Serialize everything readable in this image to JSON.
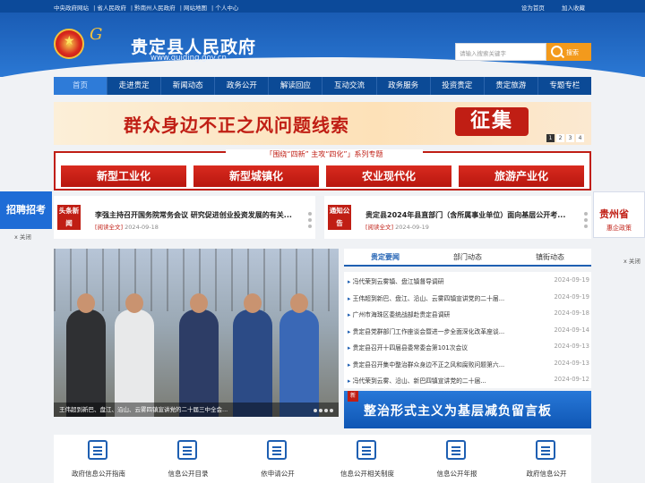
{
  "topbar": {
    "links": [
      "中央政府网站",
      "省人民政府",
      "黔南州人民政府",
      "网站地图",
      "个人中心"
    ],
    "right_links": [
      "设为首页",
      "加入收藏"
    ]
  },
  "header": {
    "title": "贵定县人民政府",
    "url": "www.guiding.gov.cn",
    "search_placeholder": "请输入搜索关键字",
    "search_label": "搜索"
  },
  "nav": {
    "items": [
      "首页",
      "走进贵定",
      "新闻动态",
      "政务公开",
      "解读回应",
      "互动交流",
      "政务服务",
      "投资贵定",
      "贵定旅游",
      "专题专栏"
    ]
  },
  "banner": {
    "text": "群众身边不正之风问题线索",
    "badge": "征集",
    "pages": [
      "1",
      "2",
      "3",
      "4"
    ]
  },
  "sihua": {
    "header": "「围绕“四新” 主攻“四化”」系列专题",
    "items": [
      "新型工业化",
      "新型城镇化",
      "农业现代化",
      "旅游产业化"
    ]
  },
  "headlines": [
    {
      "tag": "头条新闻",
      "title": "李强主持召开国务院常务会议 研究促进创业投资发展的有关...",
      "read": "[阅读全文]",
      "date": "2024-09-18"
    },
    {
      "tag": "通知公告",
      "title": "贵定县2024年县直部门（含所属事业单位）面向基层公开考...",
      "read": "[阅读全文]",
      "date": "2024-09-19"
    }
  ],
  "float": {
    "left_text": "招聘招考",
    "right_text": "贵州省",
    "right_sub": "惠企政策",
    "close": "x 关闭"
  },
  "photo": {
    "caption": "王伟超到新巴、盘江、沿山、云雾四镇宣讲党的二十届三中全会..."
  },
  "news": {
    "tabs": [
      "贵定要闻",
      "部门动态",
      "镇街动态"
    ],
    "items": [
      {
        "title": "冯代荣到云雾镇、盘江镇督导调研",
        "date": "2024-09-19"
      },
      {
        "title": "王伟超到新巴、盘江、沿山、云雾四镇宣讲党的二十届...",
        "date": "2024-09-19"
      },
      {
        "title": "广州市海珠区委统战部赴贵定县调研",
        "date": "2024-09-18"
      },
      {
        "title": "贵定县党群部门工作座谈会暨进一步全面深化改革座谈...",
        "date": "2024-09-14"
      },
      {
        "title": "贵定县召开十四届县委常委会第101次会议",
        "date": "2024-09-13"
      },
      {
        "title": "贵定县召开集中整治群众身边不正之风和腐败问题第六...",
        "date": "2024-09-13"
      },
      {
        "title": "冯代荣到云雾、沿山、新巴四镇宣讲党的二十届...",
        "date": "2024-09-12"
      }
    ],
    "promo_tag": "新",
    "promo_text": "整治形式主义为基层减负留言板"
  },
  "bottom": {
    "items": [
      "政府信息公开指南",
      "信息公开目录",
      "依申请公开",
      "信息公开相关制度",
      "信息公开年报",
      "政府信息公开"
    ]
  }
}
